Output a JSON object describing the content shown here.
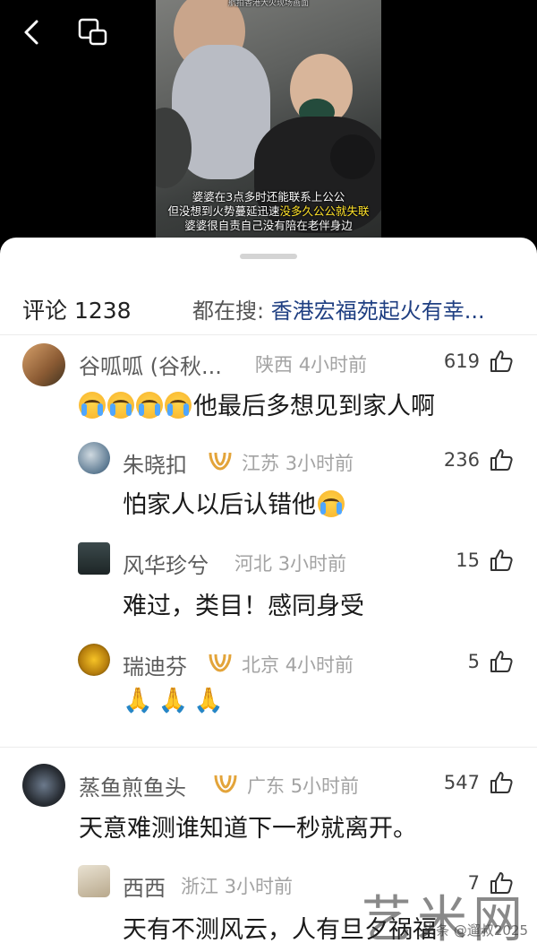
{
  "video": {
    "top_caption": "航拍香港大火现场画面",
    "caption_line1": "婆婆在3点多时还能联系上公公",
    "caption_line2_plain": "但没想到火势蔓延迅速",
    "caption_line2_highlight": "没多久公公就失联",
    "caption_line3": "婆婆很自责自己没有陪在老伴身边"
  },
  "top_bar": {
    "back_icon": "chevron-left-icon",
    "float_icon": "picture-in-picture-icon"
  },
  "comments_header": {
    "title": "评论 1238",
    "search_prefix": "都在搜:",
    "search_query": "香港宏福苑起火有幸..."
  },
  "comments": [
    {
      "name": "谷呱呱 (谷秋...",
      "location": "陕西",
      "time": "4小时前",
      "likes": "619",
      "text": "他最后多想见到家人啊",
      "emoji_prefix_count": 4,
      "vip": false
    },
    {
      "name": "朱晓扣",
      "location": "江苏",
      "time": "3小时前",
      "likes": "236",
      "text": "怕家人以后认错他",
      "emoji_suffix_count": 1,
      "vip": true
    },
    {
      "name": "风华珍兮",
      "location": "河北",
      "time": "3小时前",
      "likes": "15",
      "text": "难过，类目！感同身受",
      "vip": false
    },
    {
      "name": "瑞迪芬",
      "location": "北京",
      "time": "4小时前",
      "likes": "5",
      "text": "🙏🙏🙏",
      "vip": true
    },
    {
      "name": "蒸鱼煎鱼头",
      "location": "广东",
      "time": "5小时前",
      "likes": "547",
      "text": "天意难测谁知道下一秒就离开。",
      "vip": true
    },
    {
      "name": "西西",
      "location": "浙江",
      "time": "3小时前",
      "likes": "7",
      "text": "天有不测风云，人有旦夕祸福",
      "vip": false
    }
  ],
  "watermark": {
    "big": "艺米网",
    "small": "头条 @遛叔2025"
  },
  "colors": {
    "sheet_bg": "#ffffff",
    "link_blue": "#1f3f82",
    "vip_gold": "#e3a43a",
    "caption_highlight": "#ffe22a"
  }
}
